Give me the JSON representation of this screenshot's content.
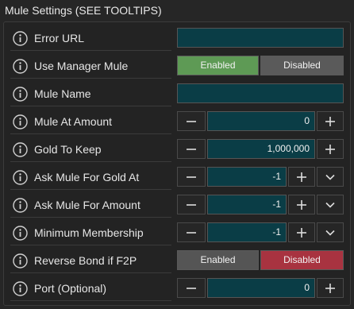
{
  "panel": {
    "title": "Mule Settings (SEE TOOLTIPS)"
  },
  "rows": [
    {
      "label": "Error URL",
      "value": ""
    },
    {
      "label": "Use Manager Mule",
      "enabled_label": "Enabled",
      "disabled_label": "Disabled",
      "selected": "Enabled"
    },
    {
      "label": "Mule Name",
      "value": ""
    },
    {
      "label": "Mule At Amount",
      "value": "0"
    },
    {
      "label": "Gold To Keep",
      "value": "1,000,000"
    },
    {
      "label": "Ask Mule For Gold At",
      "value": "-1"
    },
    {
      "label": "Ask Mule For Amount",
      "value": "-1"
    },
    {
      "label": "Minimum Membership",
      "value": "-1"
    },
    {
      "label": "Reverse Bond if F2P",
      "enabled_label": "Enabled",
      "disabled_label": "Disabled",
      "selected": "Disabled"
    },
    {
      "label": "Port (Optional)",
      "value": "0"
    }
  ],
  "icons": {
    "info": "info-icon",
    "minus": "minus-icon",
    "plus": "plus-icon",
    "dropdown": "chevron-down-icon"
  },
  "colors": {
    "field_bg": "#0a3d46",
    "enabled_active": "#5e9a55",
    "disabled_active": "#a83340",
    "inactive": "#5a5a5a"
  }
}
